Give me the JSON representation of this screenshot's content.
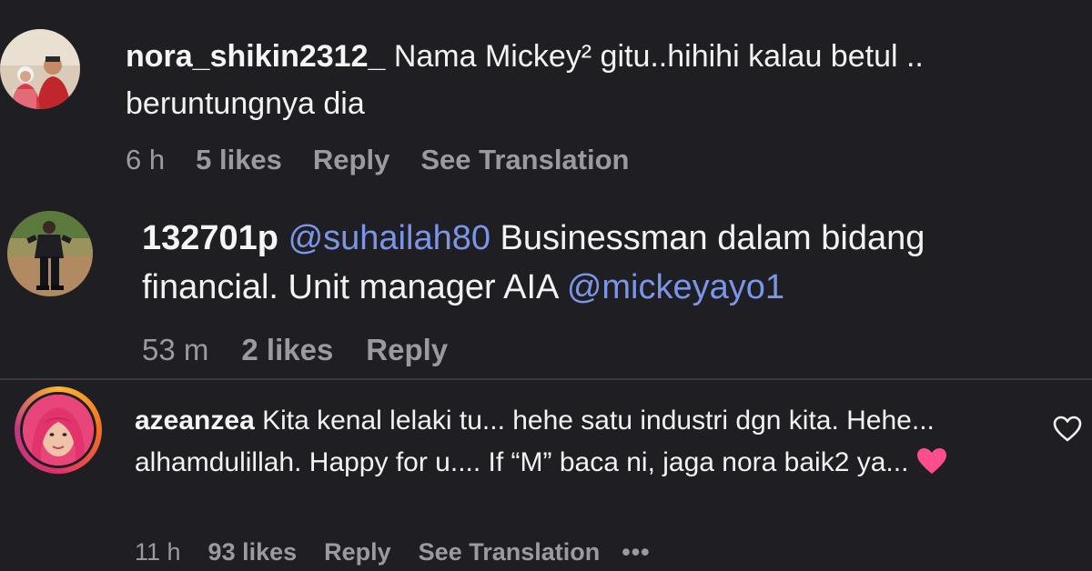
{
  "comments": [
    {
      "username": "nora_shikin2312_",
      "text": "Nama Mickey² gitu..hihihi kalau betul .. beruntungnya dia",
      "time": "6 h",
      "likes": "5 likes",
      "reply": "Reply",
      "see_translation": "See Translation",
      "avatar_icon": "profile-photo-couple"
    },
    {
      "username": "132701p",
      "mention_1": "@suhailah80",
      "text": "Businessman dalam bidang financial. Unit manager AIA",
      "mention_2": "@mickeyayo1",
      "time": "53 m",
      "likes": "2 likes",
      "reply": "Reply",
      "avatar_icon": "profile-photo-standing-man"
    },
    {
      "username": "azeanzea",
      "text": "Kita kenal lelaki tu... hehe satu industri dgn kita. Hehe... alhamdulillah. Happy for u.... If “M” baca ni, jaga nora baik2 ya...",
      "time": "11 h",
      "likes": "93 likes",
      "reply": "Reply",
      "see_translation": "See Translation",
      "more": "•••",
      "avatar_icon": "profile-photo-woman-hijab",
      "emoji_icon": "pink-heart-icon",
      "like_icon": "heart-outline-icon"
    }
  ],
  "colors": {
    "background": "#1f1f23",
    "text": "#f2f2f2",
    "meta": "#9a9aa0",
    "mention": "#7b96e8",
    "heart": "#ff4d8d"
  }
}
